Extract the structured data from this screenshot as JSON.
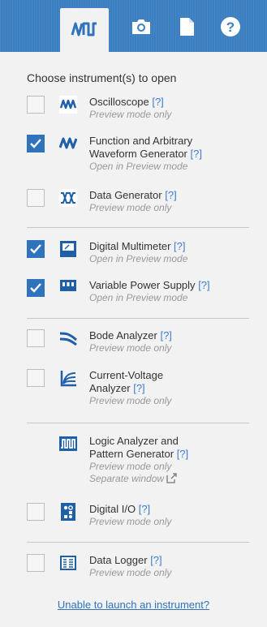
{
  "tabs": [
    {
      "icon": "waveform-icon",
      "active": true
    },
    {
      "icon": "camera-icon"
    },
    {
      "icon": "document-icon"
    },
    {
      "icon": "help-icon"
    }
  ],
  "heading": "Choose instrument(s) to open",
  "help_marker": "[?]",
  "instruments": [
    {
      "name": "Oscilloscope",
      "checked": false,
      "note": "Preview mode only",
      "icon": "oscilloscope-icon"
    },
    {
      "name_line1": "Function and Arbitrary",
      "name_line2": "Waveform Generator",
      "checked": true,
      "note": "Open in Preview mode",
      "icon": "function-generator-icon"
    },
    {
      "name": "Data Generator",
      "checked": false,
      "note": "Preview mode only",
      "icon": "data-generator-icon"
    },
    {
      "name": "Digital Multimeter",
      "checked": true,
      "note": "Open in Preview mode",
      "icon": "multimeter-icon"
    },
    {
      "name": "Variable Power Supply",
      "checked": true,
      "note": "Open in Preview mode",
      "icon": "power-supply-icon"
    },
    {
      "name": "Bode Analyzer",
      "checked": false,
      "note": "Preview mode only",
      "icon": "bode-analyzer-icon"
    },
    {
      "name_line1": "Current-Voltage",
      "name_line2": "Analyzer",
      "checked": false,
      "note": "Preview mode only",
      "icon": "iv-analyzer-icon"
    },
    {
      "name_line1": "Logic Analyzer and",
      "name_line2": "Pattern Generator",
      "note": "Preview mode only",
      "note2": "Separate window",
      "icon": "logic-analyzer-icon"
    },
    {
      "name": "Digital I/O",
      "checked": false,
      "note": "Preview mode only",
      "icon": "digital-io-icon"
    },
    {
      "name": "Data Logger",
      "checked": false,
      "note": "Preview mode only",
      "icon": "data-logger-icon"
    }
  ],
  "footer_link": "Unable to launch an instrument?",
  "colors": {
    "topbar": "#3c7fc1",
    "accent": "#2f73bd",
    "note": "#999999"
  }
}
